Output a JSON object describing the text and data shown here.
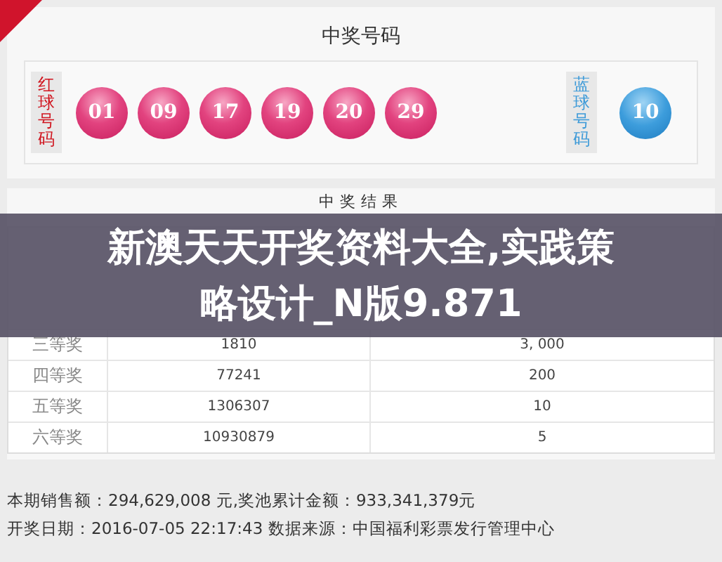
{
  "numbers": {
    "title": "中奖号码",
    "red_label": "红球号码",
    "red_balls": [
      "01",
      "09",
      "17",
      "19",
      "20",
      "29"
    ],
    "blue_label": "蓝球号码",
    "blue_balls": [
      "10"
    ]
  },
  "results": {
    "title": "中奖结果",
    "rows": [
      {
        "prize": "三等奖",
        "count": "1810",
        "amount": "3, 000"
      },
      {
        "prize": "四等奖",
        "count": "77241",
        "amount": "200"
      },
      {
        "prize": "五等奖",
        "count": "1306307",
        "amount": "10"
      },
      {
        "prize": "六等奖",
        "count": "10930879",
        "amount": "5"
      }
    ]
  },
  "footer": [
    "本期销售额：294,629,008 元,奖池累计金额：933,341,379元",
    "开奖日期：2016-07-05 22:17:43 数据来源：中国福利彩票发行管理中心"
  ],
  "banner": {
    "lines": [
      "新澳天天开奖资料大全,实践策",
      "略设计_N版9.871"
    ]
  }
}
